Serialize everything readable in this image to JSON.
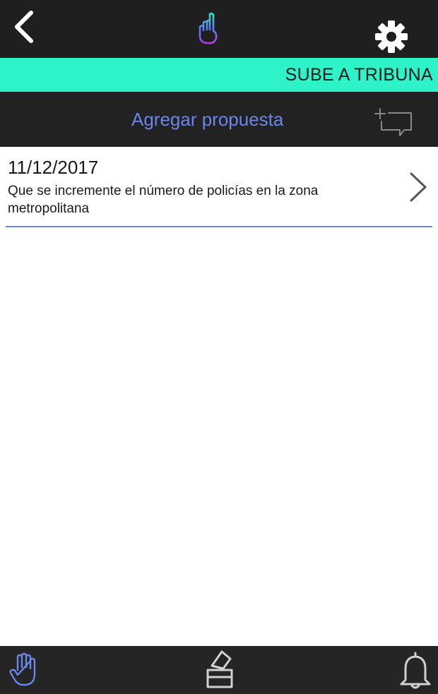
{
  "header": {
    "back_icon": "chevron-left-icon",
    "logo_icon": "raised-finger-hand-logo",
    "settings_icon": "gear-icon"
  },
  "banner": {
    "title": "SUBE A TRIBUNA",
    "color": "#2ef2c8"
  },
  "actionbar": {
    "add_label": "Agregar propuesta",
    "add_icon": "add-comment-icon",
    "link_color": "#6a86e8"
  },
  "proposals": [
    {
      "date": "11/12/2017",
      "text": "Que se incremente el número de policías en la zona metropolitana"
    }
  ],
  "bottom_nav": [
    {
      "icon": "raised-hand-icon",
      "active": true
    },
    {
      "icon": "ballot-box-icon",
      "active": false
    },
    {
      "icon": "bell-icon",
      "active": false
    }
  ]
}
